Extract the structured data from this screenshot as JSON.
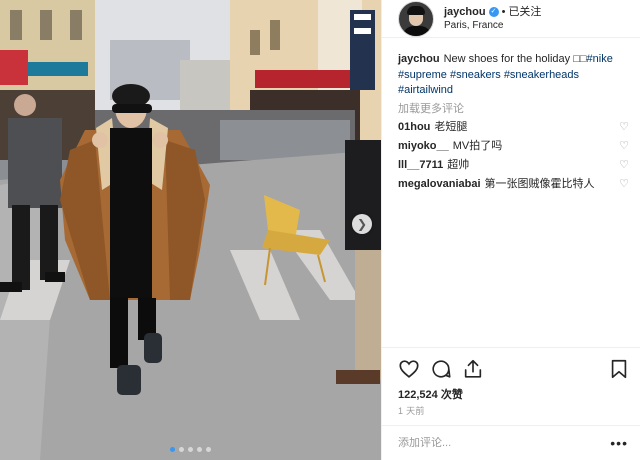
{
  "post": {
    "username": "jaychou",
    "verified_icon": "verified-badge-icon",
    "separator": "•",
    "follow_label": "已关注",
    "location": "Paris, France",
    "caption_user": "jaychou",
    "caption_text": "New shoes for the holiday ",
    "caption_emoji": "□□",
    "caption_tags_line1": "#nike",
    "hashtags": [
      "#supreme",
      "#sneakers",
      "#sneakerheads",
      "#airtailwind"
    ],
    "load_more": "加载更多评论",
    "comments": [
      {
        "user": "01hou",
        "text": "老短腿"
      },
      {
        "user": "miyoko__",
        "text": "MV拍了吗"
      },
      {
        "user": "lll__7711",
        "text": "超帅"
      },
      {
        "user": "megalovaniabai",
        "text": "第一张图贼像霍比特人"
      }
    ],
    "likes": "122,524 次赞",
    "time": "1 天前",
    "comment_placeholder": "添加评论...",
    "more_label": "•••"
  },
  "carousel": {
    "dots": 5,
    "active": 0
  },
  "colors": {
    "link": "#003569",
    "accent": "#3897f0",
    "muted": "#999999"
  }
}
